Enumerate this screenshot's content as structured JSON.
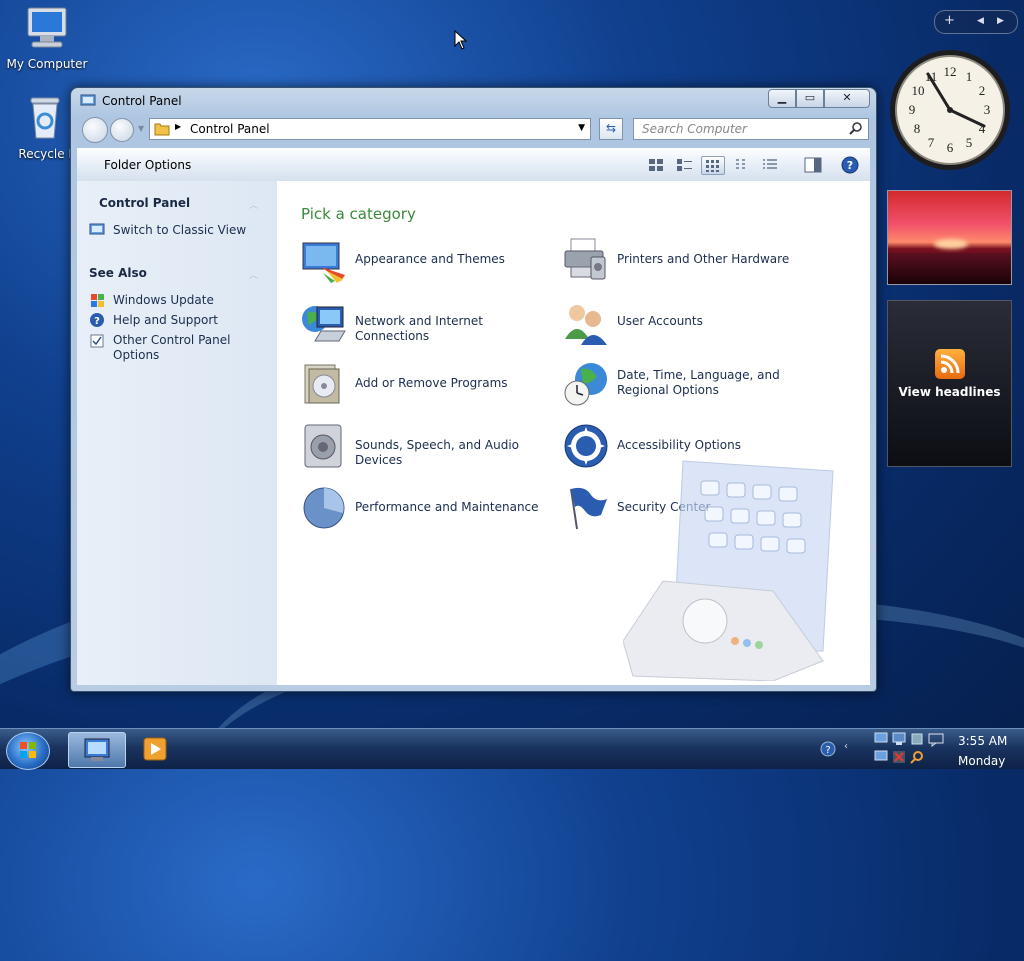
{
  "desktop": {
    "icons": [
      {
        "label": "My Computer"
      },
      {
        "label": "Recycle Bin"
      }
    ]
  },
  "gadgets": {
    "clock_numbers": [
      "12",
      "1",
      "2",
      "3",
      "4",
      "5",
      "6",
      "7",
      "8",
      "9",
      "10",
      "11"
    ],
    "feed_label": "View headlines"
  },
  "window": {
    "title": "Control Panel",
    "address_path": "Control Panel",
    "search_placeholder": "Search Computer",
    "command_bar": {
      "folder_options": "Folder Options"
    },
    "sidebar": {
      "heading": "Control Panel",
      "switch_view": "Switch to Classic View",
      "see_also_heading": "See Also",
      "links": [
        "Windows Update",
        "Help and Support",
        "Other Control Panel Options"
      ]
    },
    "main": {
      "heading": "Pick a category",
      "categories": [
        "Appearance and Themes",
        "Printers and Other Hardware",
        "Network and Internet Connections",
        "User Accounts",
        "Add or Remove Programs",
        "Date, Time, Language, and Regional Options",
        "Sounds, Speech, and Audio Devices",
        "Accessibility Options",
        "Performance and Maintenance",
        "Security Center"
      ]
    }
  },
  "taskbar": {
    "time": "3:55 AM",
    "day": "Monday"
  }
}
